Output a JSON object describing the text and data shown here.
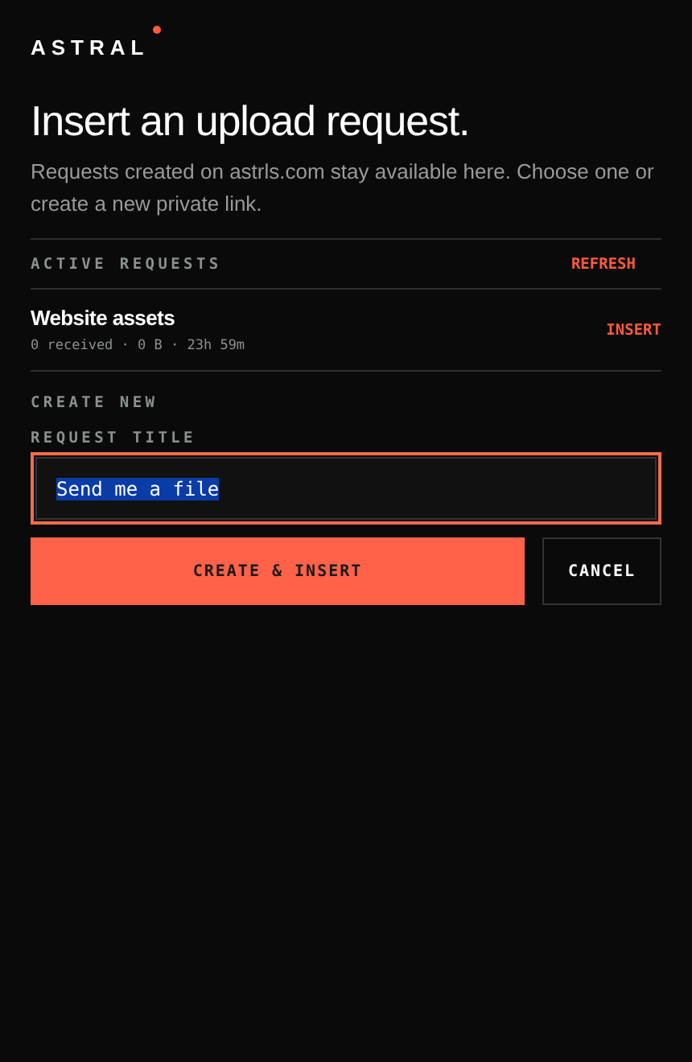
{
  "logo": {
    "text": "ASTRAL"
  },
  "title": "Insert an upload request.",
  "description": "Requests created on astrls.com stay available here. Choose one or create a new private link.",
  "active": {
    "heading": "ACTIVE REQUESTS",
    "action": "REFRESH",
    "requests": [
      {
        "name": "Website assets",
        "meta": "0 received · 0 B · 23h 59m",
        "action": "INSERT"
      }
    ]
  },
  "create": {
    "heading": "CREATE NEW",
    "field_label": "REQUEST TITLE",
    "value": "Send me a file",
    "focused": true,
    "text_selected": true
  },
  "buttons": [
    {
      "label": "CREATE & INSERT",
      "kind": "primary"
    },
    {
      "label": "CANCEL",
      "kind": "secondary"
    }
  ]
}
